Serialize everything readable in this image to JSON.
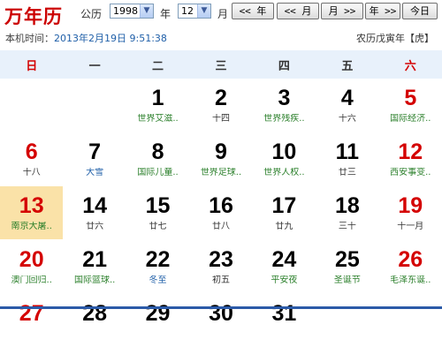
{
  "header": {
    "brand": "万年历",
    "year_label_prefix": "公历",
    "year_value": "1998",
    "year_unit": "年",
    "month_value": "12",
    "month_unit": "月",
    "buttons": [
      "<< 年",
      "<< 月",
      "月 >>",
      "年 >>",
      "今日"
    ],
    "dropdown_arrow": "chevron-down-icon"
  },
  "info": {
    "local_time_label": "本机时间：",
    "local_time_value": "2013年2月19日 9:51:38",
    "lunar_text": "农历戊寅年【虎】"
  },
  "weekdays": [
    "日",
    "一",
    "二",
    "三",
    "四",
    "五",
    "六"
  ],
  "days": [
    {
      "day": "",
      "sub": "",
      "col": 0,
      "row": 0
    },
    {
      "day": "",
      "sub": "",
      "col": 1,
      "row": 0
    },
    {
      "day": "1",
      "sub": "世界艾滋..",
      "col": 2,
      "row": 0,
      "subColor": "green"
    },
    {
      "day": "2",
      "sub": "十四",
      "col": 3,
      "row": 0
    },
    {
      "day": "3",
      "sub": "世界残疾..",
      "col": 4,
      "row": 0,
      "subColor": "green"
    },
    {
      "day": "4",
      "sub": "十六",
      "col": 5,
      "row": 0
    },
    {
      "day": "5",
      "sub": "国际经济..",
      "col": 6,
      "row": 0,
      "subColor": "green",
      "red": true
    },
    {
      "day": "6",
      "sub": "十八",
      "col": 0,
      "row": 1,
      "red": true
    },
    {
      "day": "7",
      "sub": "大雪",
      "col": 1,
      "row": 1,
      "subColor": "blue"
    },
    {
      "day": "8",
      "sub": "国际儿童..",
      "col": 2,
      "row": 1,
      "subColor": "green"
    },
    {
      "day": "9",
      "sub": "世界足球..",
      "col": 3,
      "row": 1,
      "subColor": "green"
    },
    {
      "day": "10",
      "sub": "世界人权..",
      "col": 4,
      "row": 1,
      "subColor": "green"
    },
    {
      "day": "11",
      "sub": "廿三",
      "col": 5,
      "row": 1
    },
    {
      "day": "12",
      "sub": "西安事变..",
      "col": 6,
      "row": 1,
      "subColor": "green",
      "red": true
    },
    {
      "day": "13",
      "sub": "南京大屠..",
      "col": 0,
      "row": 2,
      "subColor": "green",
      "red": true,
      "today": true
    },
    {
      "day": "14",
      "sub": "廿六",
      "col": 1,
      "row": 2
    },
    {
      "day": "15",
      "sub": "廿七",
      "col": 2,
      "row": 2
    },
    {
      "day": "16",
      "sub": "廿八",
      "col": 3,
      "row": 2
    },
    {
      "day": "17",
      "sub": "廿九",
      "col": 4,
      "row": 2
    },
    {
      "day": "18",
      "sub": "三十",
      "col": 5,
      "row": 2
    },
    {
      "day": "19",
      "sub": "十一月",
      "col": 6,
      "row": 2,
      "red": true
    },
    {
      "day": "20",
      "sub": "澳门回归..",
      "col": 0,
      "row": 3,
      "subColor": "green",
      "red": true
    },
    {
      "day": "21",
      "sub": "国际篮球..",
      "col": 1,
      "row": 3,
      "subColor": "green"
    },
    {
      "day": "22",
      "sub": "冬至",
      "col": 2,
      "row": 3,
      "subColor": "blue"
    },
    {
      "day": "23",
      "sub": "初五",
      "col": 3,
      "row": 3
    },
    {
      "day": "24",
      "sub": "平安夜",
      "col": 4,
      "row": 3,
      "subColor": "green"
    },
    {
      "day": "25",
      "sub": "圣诞节",
      "col": 5,
      "row": 3,
      "subColor": "green"
    },
    {
      "day": "26",
      "sub": "毛泽东诞..",
      "col": 6,
      "row": 3,
      "subColor": "green",
      "red": true
    },
    {
      "day": "27",
      "sub": "",
      "col": 0,
      "row": 4,
      "red": true
    },
    {
      "day": "28",
      "sub": "",
      "col": 1,
      "row": 4
    },
    {
      "day": "29",
      "sub": "",
      "col": 2,
      "row": 4
    },
    {
      "day": "30",
      "sub": "",
      "col": 3,
      "row": 4
    },
    {
      "day": "31",
      "sub": "",
      "col": 4,
      "row": 4
    }
  ]
}
